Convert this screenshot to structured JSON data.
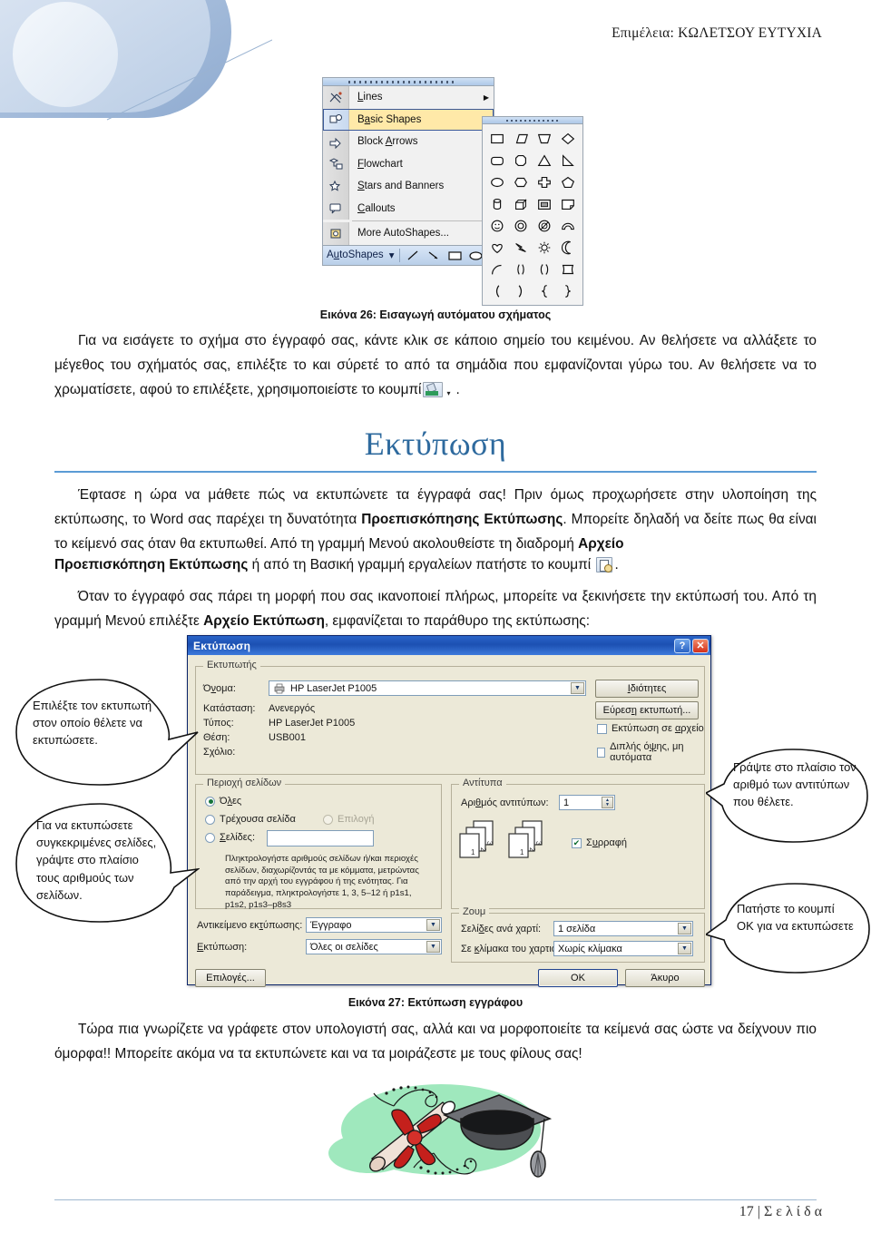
{
  "header": {
    "text": "Επιμέλεια: ΚΩΛΕΤΣΟΥ ΕΥΤΥΧΙΑ"
  },
  "colors": {
    "heading_blue": "#2e6a9e",
    "rule_blue": "#5b9bd5",
    "dialog_face": "#ece9d8",
    "titlebar_blue": "#1c50b2",
    "selection_yellow": "#ffe9a8",
    "clipart_green": "#9fe8bd",
    "clipart_red": "#cc2222"
  },
  "autoshapes_figure": {
    "menu_items": [
      {
        "label": "Lines",
        "icon": "lines-icon",
        "has_submenu": true,
        "selected": false
      },
      {
        "label": "Basic Shapes",
        "icon": "basic-shapes-icon",
        "has_submenu": true,
        "selected": true
      },
      {
        "label": "Block Arrows",
        "icon": "block-arrows-icon",
        "has_submenu": true,
        "selected": false
      },
      {
        "label": "Flowchart",
        "icon": "flowchart-icon",
        "has_submenu": true,
        "selected": false
      },
      {
        "label": "Stars and Banners",
        "icon": "stars-banners-icon",
        "has_submenu": true,
        "selected": false
      },
      {
        "label": "Callouts",
        "icon": "callouts-icon",
        "has_submenu": true,
        "selected": false
      },
      {
        "label": "More AutoShapes...",
        "icon": "more-autoshapes-icon",
        "has_submenu": false,
        "selected": false
      }
    ],
    "toolbar": {
      "autoshapes_label": "AutoShapes",
      "dropdown_glyph": "▾",
      "tools": [
        "line-tool-icon",
        "arrow-tool-icon",
        "rectangle-tool-icon",
        "oval-tool-icon"
      ]
    },
    "palette_title": "basic-shapes-palette",
    "palette_shapes": [
      "rectangle",
      "parallelogram",
      "trapezoid",
      "diamond",
      "rounded-rectangle",
      "octagon",
      "triangle",
      "right-triangle",
      "ellipse",
      "hexagon",
      "cross",
      "pentagon",
      "cylinder",
      "cube",
      "bevel",
      "folded-corner",
      "smiley-face",
      "donut",
      "no-symbol",
      "arc-block",
      "heart",
      "lightning-bolt",
      "sun",
      "moon",
      "arc",
      "round-brackets",
      "round-braces",
      "plaque",
      "left-bracket",
      "right-bracket",
      "left-brace",
      "right-brace"
    ]
  },
  "captions": {
    "figure_26": "Εικόνα 26: Εισαγωγή αυτόματου σχήματος",
    "figure_27": "Εικόνα 27: Εκτύπωση εγγράφου"
  },
  "paragraphs": {
    "p1_a": "Για να εισάγετε το σχήμα στο έγγραφό σας, κάντε κλικ σε κάποιο σημείο του κειμένου. Αν θελήσετε να αλλάξετε το μέγεθος του σχήματός σας, επιλέξτε το και σύρετέ το από τα σημάδια που εμφανίζονται γύρω του. Αν θελήσετε",
    "p1_b": "να το χρωματίσετε, αφού το επιλέξετε, χρησιμοποιείστε το κουμπί",
    "p1_end": ".",
    "p2_a": "Έφτασε η ώρα να μάθετε πώς να εκτυπώνετε τα έγγραφά σας! Πριν όμως προχωρήσετε στην υλοποίηση της εκτύπωσης, το Word σας παρέχει τη δυνατότητα ",
    "p2_b1": "Προεπισκόπησης Εκτύπωσης",
    "p2_c": ". Μπορείτε δηλαδή να δείτε πως θα είναι το κείμενό σας όταν θα εκτυπωθεί.    Από τη γραμμή Μενού ακολουθείστε τη διαδρομή ",
    "p2_b2": "Αρχείο",
    "p3_b": "Προεπισκόπηση Εκτύπωσης",
    "p3_a": " ή από τη Βασική γραμμή εργαλείων πατήστε το κουμπί",
    "p3_end": ".",
    "p4_a": "Όταν το έγγραφό σας πάρει τη μορφή που σας ικανοποιεί πλήρως, μπορείτε να ξεκινήσετε την εκτύπωσή του. Από τη γραμμή Μενού επιλέξτε ",
    "p4_b1": "Αρχείο",
    "p4_mid": "    ",
    "p4_b2": "Εκτύπωση",
    "p4_c": ", εμφανίζεται το παράθυρο της εκτύπωσης:",
    "p5": "Τώρα πια γνωρίζετε να γράφετε στον υπολογιστή σας, αλλά και να μορφοποιείτε τα κείμενά σας ώστε να δείχνουν πιο όμορφα!! Μπορείτε ακόμα να τα εκτυπώνετε και να τα μοιράζεστε με τους φίλους σας!"
  },
  "section_heading": {
    "title": "Εκτύπωση"
  },
  "print_dialog": {
    "title": "Εκτύπωση",
    "titlebar_buttons": {
      "help": "?",
      "close": "✕"
    },
    "printer_group": {
      "legend": "Εκτυπωτής",
      "name_label": "Όνομα:",
      "name_value": "HP LaserJet P1005",
      "status_label": "Κατάσταση:",
      "status_value": "Ανενεργός",
      "type_label": "Τύπος:",
      "type_value": "HP LaserJet P1005",
      "location_label": "Θέση:",
      "location_value": "USB001",
      "comment_label": "Σχόλιο:",
      "comment_value": "",
      "properties_button": "Ιδιότητες",
      "find_printer_button": "Εύρεση εκτυπωτή...",
      "print_to_file_checkbox": "Εκτύπωση σε αρχείο",
      "print_to_file_checked": false,
      "manual_duplex_checkbox": "Διπλής όψης, μη αυτόματα",
      "manual_duplex_checked": false
    },
    "page_range_group": {
      "legend": "Περιοχή σελίδων",
      "all_radio": "Όλες",
      "all_selected": true,
      "current_radio": "Τρέχουσα σελίδα",
      "current_selected": false,
      "selection_radio": "Επιλογή",
      "selection_disabled": true,
      "pages_radio": "Σελίδες:",
      "pages_selected": false,
      "pages_value": "",
      "hint": "Πληκτρολογήστε αριθμούς σελίδων ή/και περιοχές σελίδων, διαχωρίζοντάς τα με κόμματα, μετρώντας από την αρχή του εγγράφου ή της ενότητας. Για παράδειγμα, πληκτρολογήστε 1, 3, 5–12 ή p1s1, p1s2, p1s3–p8s3"
    },
    "copies_group": {
      "legend": "Αντίτυπα",
      "number_label": "Αριθμός αντιτύπων:",
      "number_value": "1",
      "collate_checkbox": "Συρραφή",
      "collate_checked": true,
      "page_numbers": [
        "1",
        "2",
        "3"
      ]
    },
    "print_what": {
      "object_label": "Αντικείμενο εκτύπωσης:",
      "object_value": "Έγγραφο",
      "print_label": "Εκτύπωση:",
      "print_value": "Όλες οι σελίδες"
    },
    "zoom_group": {
      "legend": "Ζουμ",
      "pages_per_sheet_label": "Σελίδες ανά χαρτί:",
      "pages_per_sheet_value": "1 σελίδα",
      "scale_label": "Σε κλίμακα του χαρτιού:",
      "scale_value": "Χωρίς κλίμακα"
    },
    "buttons": {
      "options": "Επιλογές...",
      "ok": "OK",
      "cancel": "Άκυρο"
    }
  },
  "callouts": [
    {
      "id": "callout-printer",
      "text": "Επιλέξτε τον εκτυπωτή στον οποίο θέλετε να εκτυπώσετε."
    },
    {
      "id": "callout-pages",
      "text": "Για να εκτυπώσετε συγκεκριμένες σελίδες, γράψτε στο πλαίσιο τους αριθμούς των σελίδων."
    },
    {
      "id": "callout-copies",
      "text": "Γράψτε στο πλαίσιο τον αριθμό των αντιτύπων που θέλετε."
    },
    {
      "id": "callout-ok",
      "text": "Πατήστε το κουμπί ΟΚ για να εκτυπώσετε"
    }
  ],
  "bottom_image": {
    "name": "graduation-cap-diploma-clipart"
  },
  "footer": {
    "page_text": "17 | Σ ε λ ί δ α"
  }
}
